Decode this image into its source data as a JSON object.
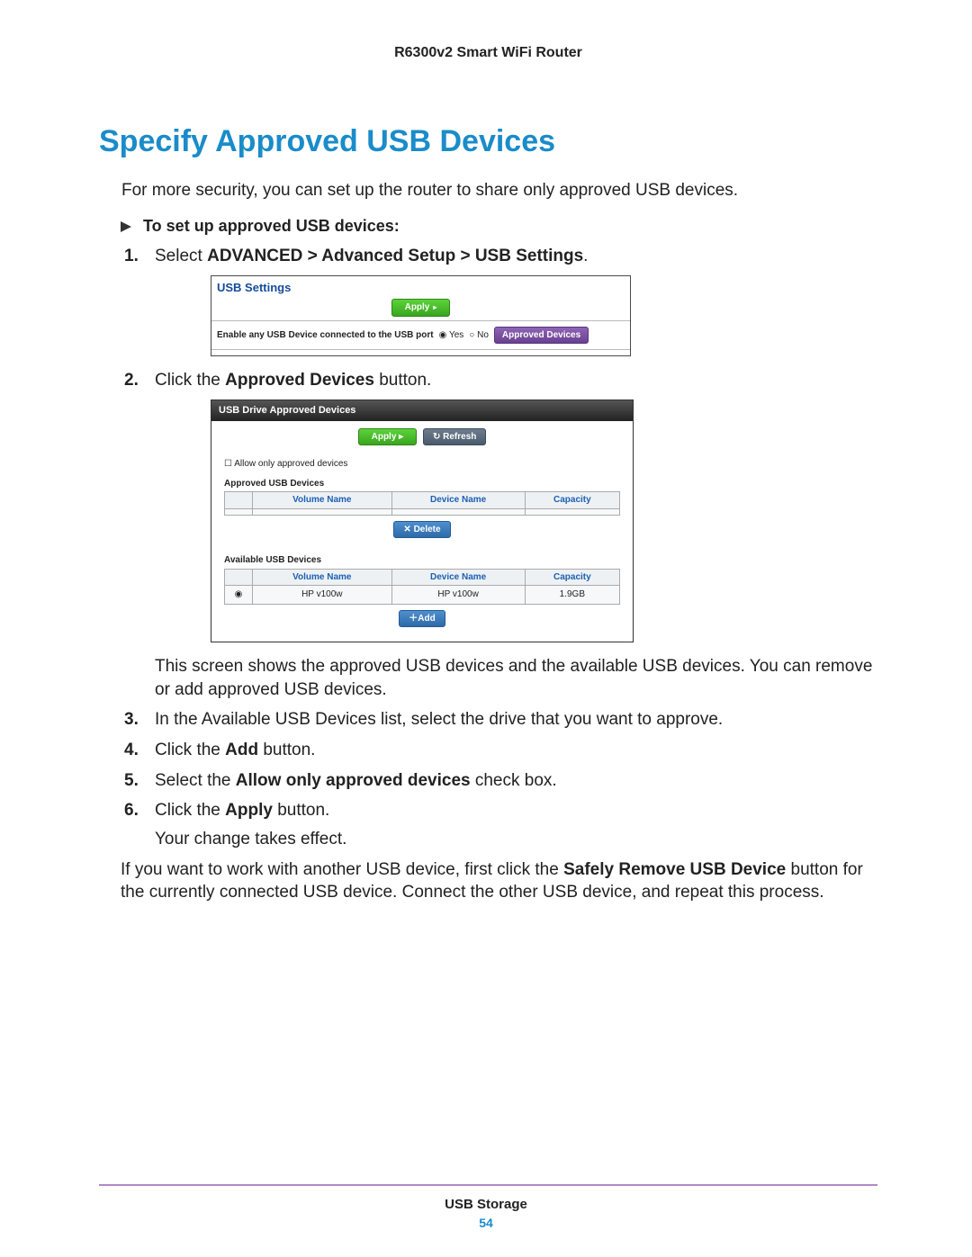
{
  "doc_header": "R6300v2 Smart WiFi Router",
  "heading": "Specify Approved USB Devices",
  "intro": "For more security, you can set up the router to share only approved USB devices.",
  "subhead": "To set up approved USB devices:",
  "steps": {
    "s1_pre": "Select ",
    "s1_bold": "ADVANCED > Advanced Setup > USB Settings",
    "s1_post": ".",
    "s2_pre": "Click the ",
    "s2_bold": "Approved Devices",
    "s2_post": " button.",
    "s2_after": "This screen shows the approved USB devices and the available USB devices. You can remove or add approved USB devices.",
    "s3": "In the Available USB Devices list, select the drive that you want to approve.",
    "s4_pre": "Click the ",
    "s4_bold": "Add",
    "s4_post": " button.",
    "s5_pre": "Select the ",
    "s5_bold": "Allow only approved devices",
    "s5_post": " check box.",
    "s6_pre": "Click the ",
    "s6_bold": "Apply",
    "s6_post": " button.",
    "s6_after": "Your change takes effect."
  },
  "closing_pre": "If you want to work with another USB device, first click the ",
  "closing_bold": "Safely Remove USB Device",
  "closing_post": " button for the currently connected USB device. Connect the other USB device, and repeat this process.",
  "shot1": {
    "header": "USB Settings",
    "apply": "Apply",
    "row_label": "Enable any USB Device connected to the USB port",
    "yes": "Yes",
    "no": "No",
    "approved_btn": "Approved Devices"
  },
  "shot2": {
    "title": "USB Drive Approved Devices",
    "apply": "Apply ▸",
    "refresh": "↻ Refresh",
    "allow_cb": "Allow only approved devices",
    "t1_label": "Approved USB Devices",
    "cols": {
      "vol": "Volume Name",
      "dev": "Device Name",
      "cap": "Capacity"
    },
    "delete_btn": "✕ Delete",
    "t2_label": "Available USB Devices",
    "row1": {
      "vol": "HP v100w",
      "dev": "HP v100w",
      "cap": "1.9GB"
    },
    "add_btn": "＋Add"
  },
  "footer": {
    "label": "USB Storage",
    "page": "54"
  }
}
